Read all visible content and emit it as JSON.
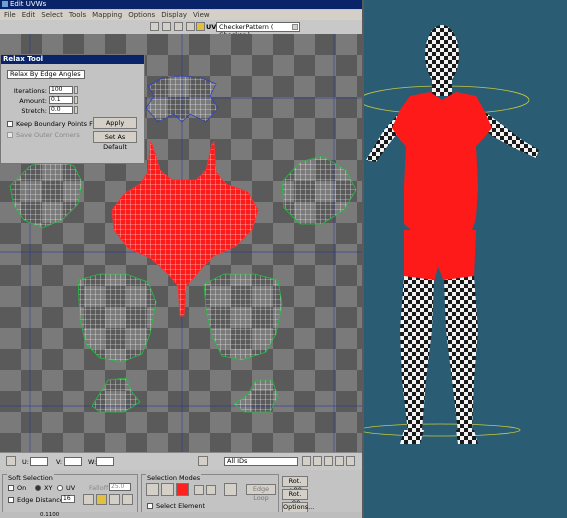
{
  "window": {
    "title": "Edit UVWs"
  },
  "menu": [
    "File",
    "Edit",
    "Select",
    "Tools",
    "Mapping",
    "Options",
    "Display",
    "View"
  ],
  "toolbar": {
    "uv_label": "UV",
    "map_dropdown": "CheckerPattern  ( Checker )"
  },
  "relax_tool": {
    "title": "Relax Tool",
    "mode": "Relax By Edge Angles",
    "iterations_label": "Iterations:",
    "iterations_value": "100",
    "amount_label": "Amount:",
    "amount_value": "0.1",
    "stretch_label": "Stretch:",
    "stretch_value": "0.0",
    "keep_boundary_label": "Keep Boundary Points Fixed",
    "save_outer_label": "Save Outer Corners",
    "apply_button": "Apply",
    "set_default_button": "Set As Default"
  },
  "status_row": {
    "u_label": "U:",
    "v_label": "V:",
    "w_label": "W:",
    "ids_select": "All IDs"
  },
  "soft_selection": {
    "title": "Soft Selection",
    "on_label": "On",
    "xy_label": "XY",
    "uv_label": "UV",
    "falloff_label": "Falloff:",
    "falloff_value": "25.0",
    "edge_distance_label": "Edge Distance",
    "edge_distance_value": "16"
  },
  "selection_modes": {
    "title": "Selection Modes",
    "edge_loop_button": "Edge Loop",
    "select_element_label": "Select Element"
  },
  "rotate": {
    "rot_plus": "Rot. +90",
    "rot_minus": "Rot. -90",
    "options": "Options..."
  },
  "bottom_strip": {
    "value": "0.1100"
  },
  "colors": {
    "shirt_red": "#ff1a1a",
    "viewport_bg": "#2a5d73",
    "title_blue": "#0a246a"
  }
}
